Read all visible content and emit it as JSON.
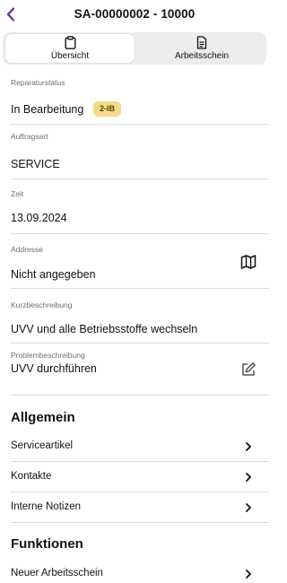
{
  "header": {
    "title": "SA-00000002 - 10000",
    "accent": "#6a2aa0"
  },
  "tabs": [
    {
      "label": "Übersicht",
      "icon": "clipboard-icon",
      "active": true
    },
    {
      "label": "Arbeitsschein",
      "icon": "document-icon",
      "active": false
    }
  ],
  "fields": {
    "status": {
      "label": "Reparaturstatus",
      "value": "In Bearbeitung",
      "badge": "2-IB",
      "badge_color": "#f7d98a"
    },
    "auftragsart": {
      "label": "Auftragsart",
      "value": "SERVICE"
    },
    "zeit": {
      "label": "Zeit",
      "value": "13.09.2024"
    },
    "adresse": {
      "label": "Addresse",
      "value": "Nicht angegeben",
      "icon": "map-icon"
    },
    "kurz": {
      "label": "Kurzbeschreibung",
      "value": "UVV und alle Betriebsstoffe wechseln"
    },
    "problem": {
      "label": "Problembeschreibung",
      "value": "UVV durchführen",
      "icon": "edit-icon"
    }
  },
  "allgemein": {
    "title": "Allgemein",
    "items": [
      {
        "label": "Serviceartikel"
      },
      {
        "label": "Kontakte"
      },
      {
        "label": "Interne Notizen"
      }
    ]
  },
  "funktionen": {
    "title": "Funktionen",
    "items": [
      {
        "label": "Neuer Arbeitsschein"
      }
    ]
  }
}
